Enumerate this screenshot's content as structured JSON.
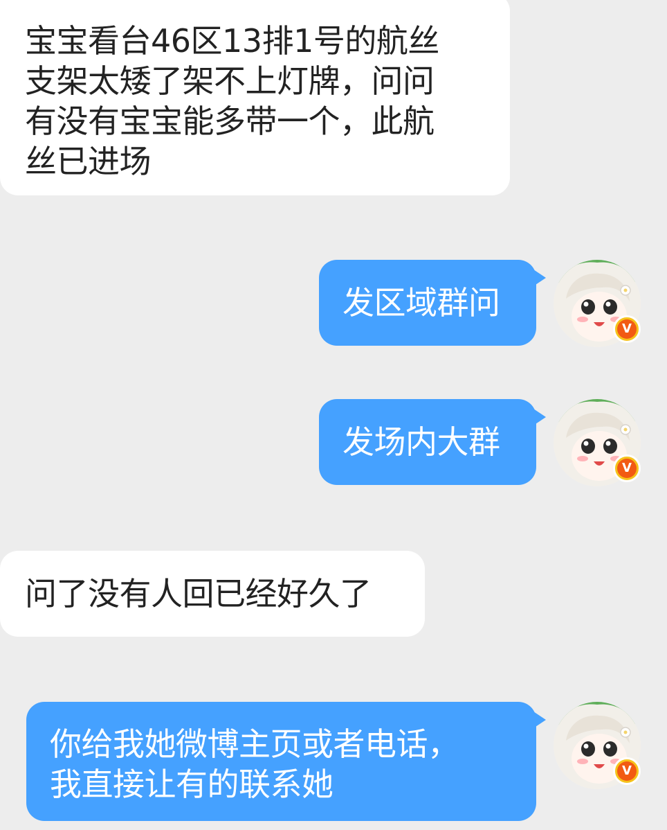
{
  "messages": [
    {
      "side": "incoming",
      "text": "宝宝看台46区13排1号的航丝\n支架太矮了架不上灯牌，问问\n有没有宝宝能多带一个，此航\n丝已进场"
    },
    {
      "side": "outgoing",
      "text": "发区域群问",
      "verified_badge": "V"
    },
    {
      "side": "outgoing",
      "text": "发场内大群",
      "verified_badge": "V"
    },
    {
      "side": "incoming",
      "text": "问了没有人回已经好久了"
    },
    {
      "side": "outgoing",
      "text": "你给我她微博主页或者电话，\n我直接让有的联系她",
      "verified_badge": "V"
    }
  ],
  "colors": {
    "background": "#ededed",
    "incoming_bubble": "#ffffff",
    "outgoing_bubble": "#45a1ff",
    "verified_badge": "#f25a12"
  },
  "icons": {
    "avatar": "anime-girl-avatar",
    "badge": "verified-v-badge"
  }
}
